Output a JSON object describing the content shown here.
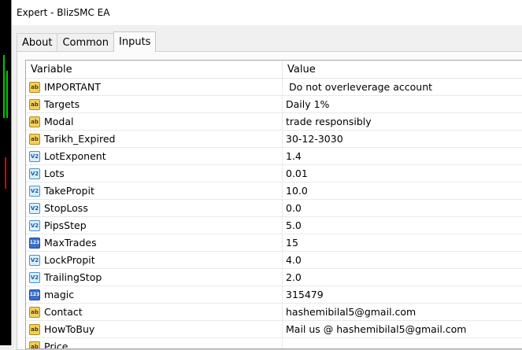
{
  "window": {
    "title": "Expert - BlizSMC EA"
  },
  "tabs": [
    {
      "label": "About"
    },
    {
      "label": "Common"
    },
    {
      "label": "Inputs"
    }
  ],
  "table": {
    "headers": {
      "variable": "Variable",
      "value": "Value"
    },
    "rows": [
      {
        "icon": "string-icon",
        "badge": "ab",
        "name": "IMPORTANT",
        "value": "Do not overleverage account"
      },
      {
        "icon": "string-icon",
        "badge": "ab",
        "name": "Targets",
        "value": "Daily 1%"
      },
      {
        "icon": "string-icon",
        "badge": "ab",
        "name": "Modal",
        "value": "trade responsibly"
      },
      {
        "icon": "string-icon",
        "badge": "ab",
        "name": "Tarikh_Expired",
        "value": "30-12-3030"
      },
      {
        "icon": "double-icon",
        "badge": "V2",
        "name": "LotExponent",
        "value": "1.4"
      },
      {
        "icon": "double-icon",
        "badge": "V2",
        "name": "Lots",
        "value": "0.01"
      },
      {
        "icon": "double-icon",
        "badge": "V2",
        "name": "TakePropit",
        "value": "10.0"
      },
      {
        "icon": "double-icon",
        "badge": "V2",
        "name": "StopLoss",
        "value": "0.0"
      },
      {
        "icon": "double-icon",
        "badge": "V2",
        "name": "PipsStep",
        "value": "5.0"
      },
      {
        "icon": "integer-icon",
        "badge": "123",
        "name": "MaxTrades",
        "value": "15"
      },
      {
        "icon": "double-icon",
        "badge": "V2",
        "name": "LockPropit",
        "value": "4.0"
      },
      {
        "icon": "double-icon",
        "badge": "V2",
        "name": "TrailingStop",
        "value": "2.0"
      },
      {
        "icon": "integer-icon",
        "badge": "123",
        "name": "magic",
        "value": "315479"
      },
      {
        "icon": "string-icon",
        "badge": "ab",
        "name": "Contact",
        "value": "hashemibilal5@gmail.com"
      },
      {
        "icon": "string-icon",
        "badge": "ab",
        "name": "HowToBuy",
        "value": "Mail us @ hashemibilal5@gmail.com"
      },
      {
        "icon": "string-icon",
        "badge": "ab",
        "name": "Price",
        "value": ""
      }
    ]
  },
  "colors": {
    "string_badge": "#f0d060",
    "double_badge": "#d8efff",
    "integer_badge": "#3a70c8",
    "chart_background": "#000000",
    "chart_up": "#00c800",
    "chart_down": "#e00000"
  }
}
